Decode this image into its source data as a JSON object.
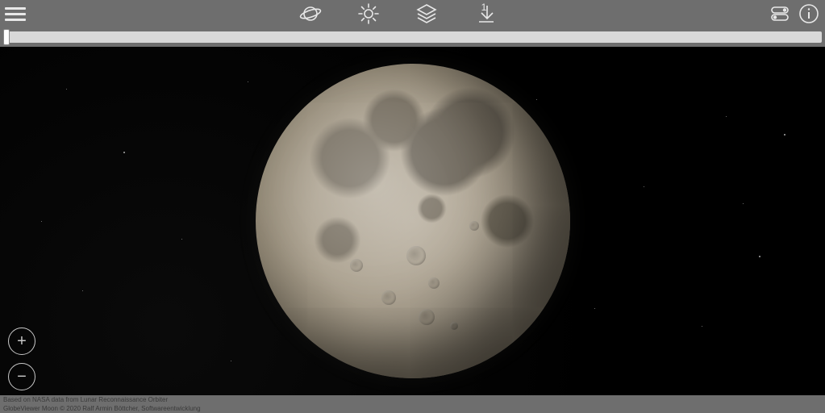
{
  "toolbar": {
    "menu_label": "Menu",
    "center_icons": [
      {
        "name": "planet-icon"
      },
      {
        "name": "sun-icon"
      },
      {
        "name": "layers-icon"
      },
      {
        "name": "download-icon",
        "badge": "1"
      }
    ],
    "right_icons": [
      {
        "name": "settings-toggle-icon"
      },
      {
        "name": "info-icon"
      }
    ]
  },
  "slider": {
    "value": 0,
    "min": 0,
    "max": 100
  },
  "zoom": {
    "in_label": "+",
    "out_label": "−"
  },
  "footer": {
    "line1": "Based on NASA data from Lunar Reconnaissance Orbiter",
    "line2": "GlobeViewer Moon © 2020 Ralf Armin Böttcher, Softwareentwicklung"
  }
}
